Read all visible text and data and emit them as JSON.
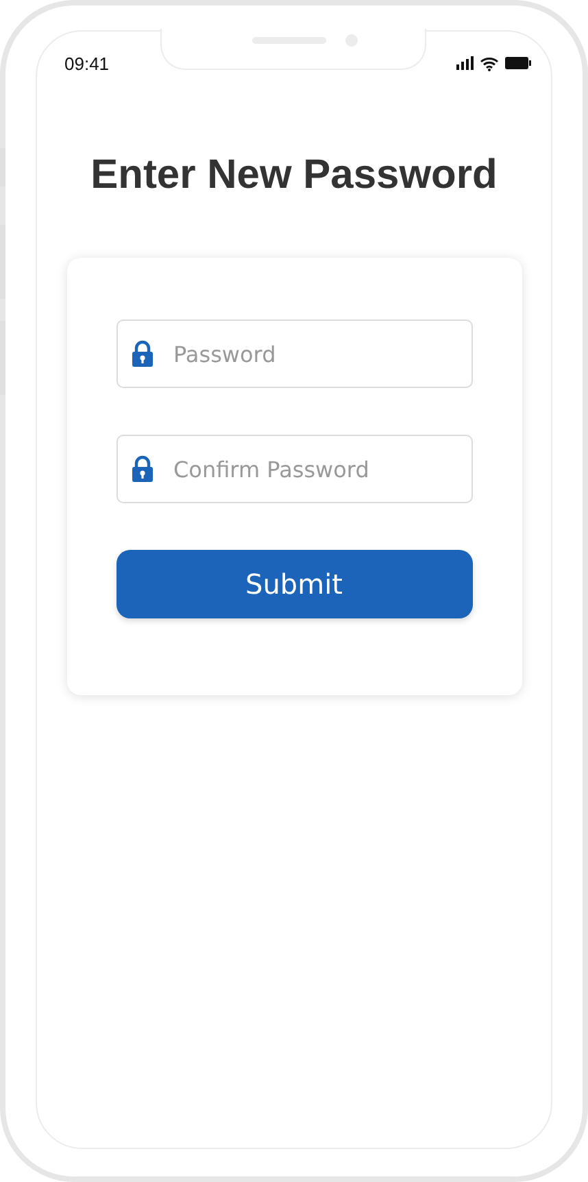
{
  "status_bar": {
    "time": "09:41"
  },
  "title": "Enter New Password",
  "fields": [
    {
      "placeholder": "Password"
    },
    {
      "placeholder": "Confirm Password"
    }
  ],
  "submit_button": "Submit"
}
